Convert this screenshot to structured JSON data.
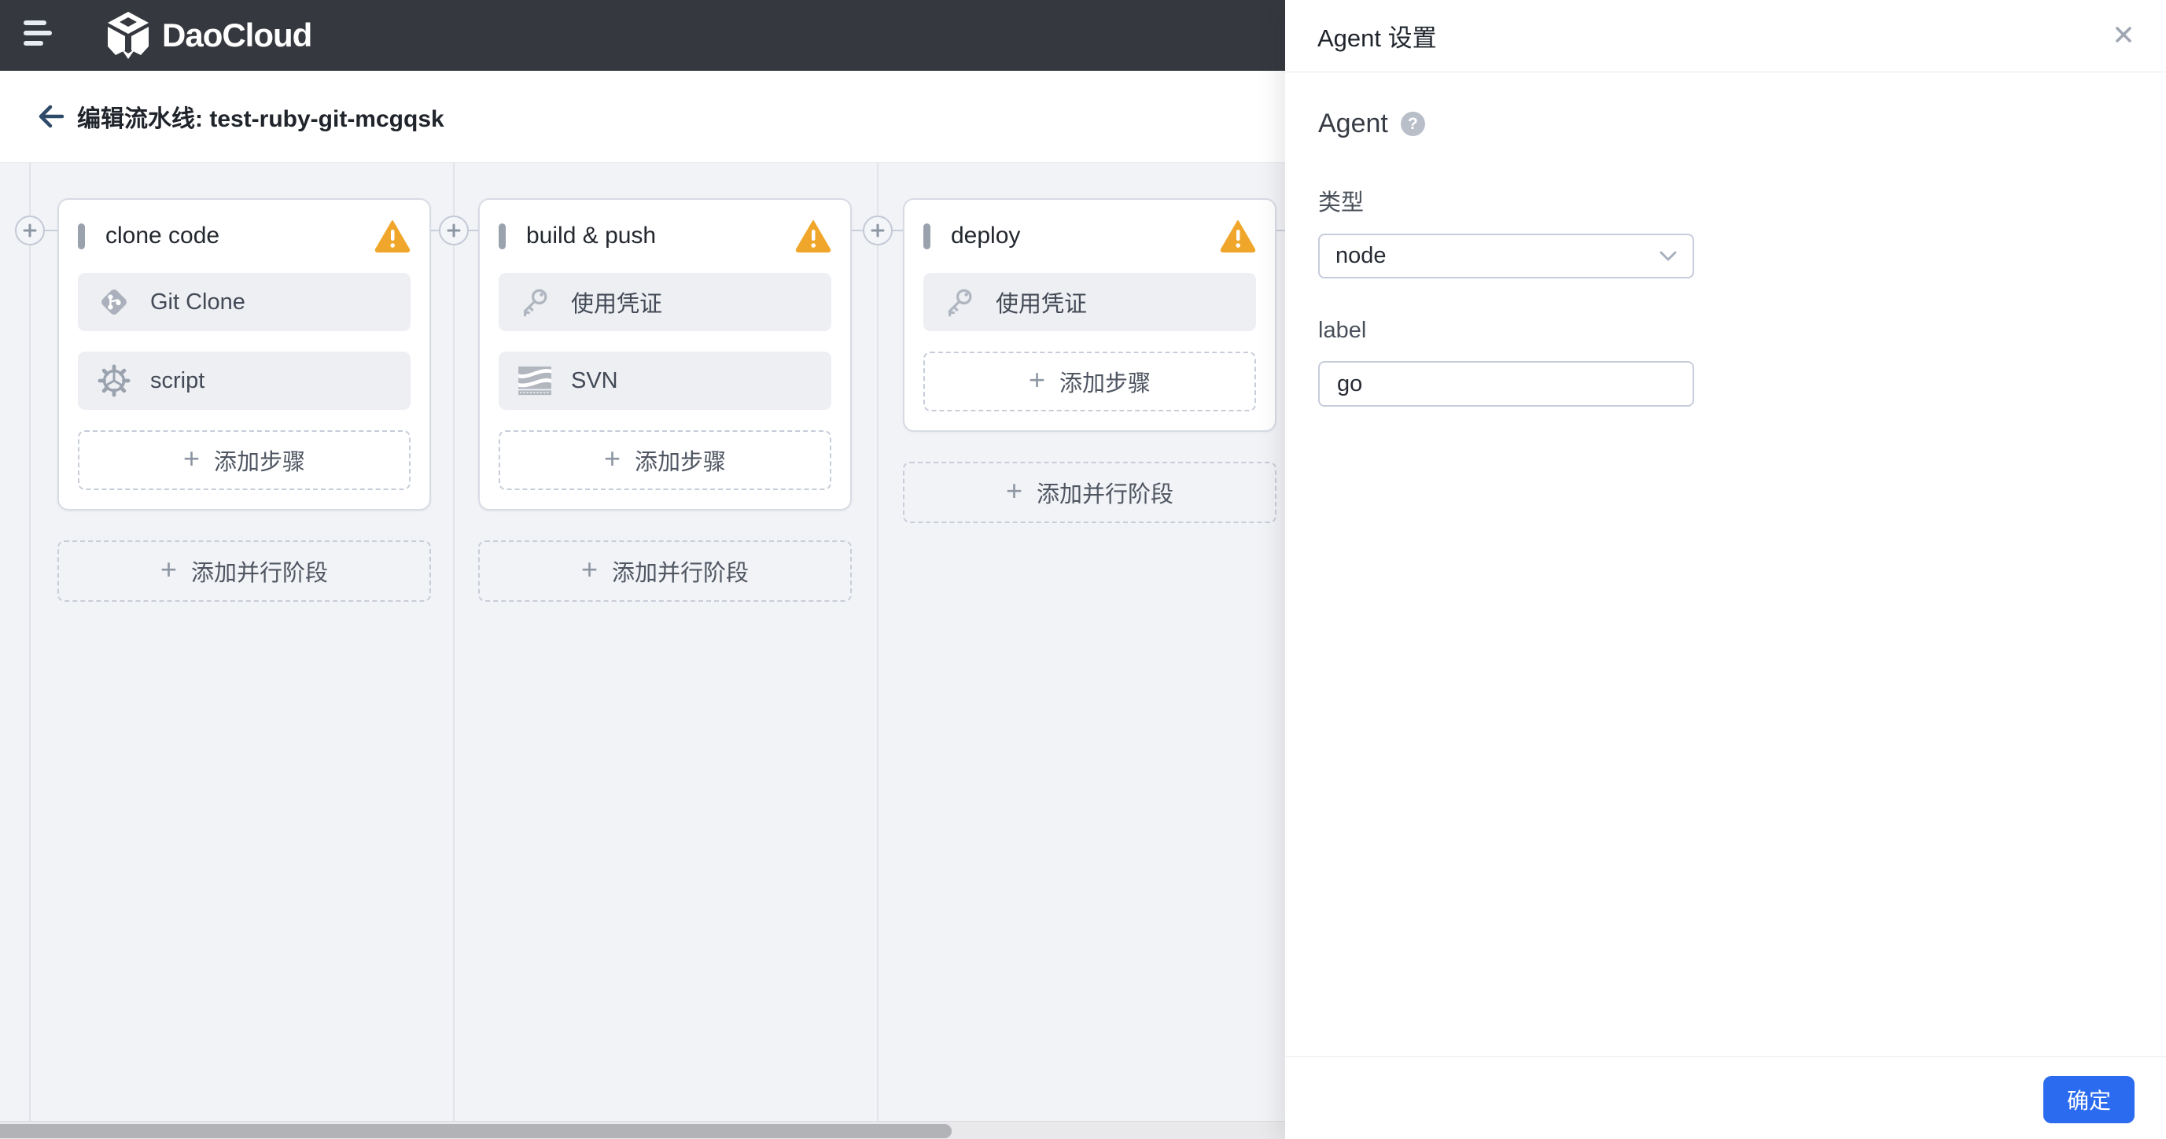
{
  "navbar": {
    "brand": "DaoCloud",
    "icons": [
      "menu-icon",
      "daocloud-logo"
    ]
  },
  "header": {
    "title": "编辑流水线: test-ruby-git-mcgqsk",
    "back_icon": "arrow-left-icon"
  },
  "pipeline": {
    "stages": [
      {
        "name": "clone code",
        "warning_icon": "warning-triangle-icon",
        "steps": [
          {
            "icon": "git-icon",
            "label": "Git Clone"
          },
          {
            "icon": "gear-icon",
            "label": "script"
          }
        ],
        "add_step_label": "添加步骤",
        "add_parallel_label": "添加并行阶段"
      },
      {
        "name": "build & push",
        "warning_icon": "warning-triangle-icon",
        "steps": [
          {
            "icon": "key-icon",
            "label": "使用凭证"
          },
          {
            "icon": "svn-icon",
            "label": "SVN"
          }
        ],
        "add_step_label": "添加步骤",
        "add_parallel_label": "添加并行阶段"
      },
      {
        "name": "deploy",
        "warning_icon": "warning-triangle-icon",
        "steps": [
          {
            "icon": "key-icon",
            "label": "使用凭证"
          }
        ],
        "add_step_label": "添加步骤",
        "add_parallel_label": "添加并行阶段"
      }
    ],
    "plus_symbol": "+"
  },
  "panel": {
    "title": "Agent 设置",
    "close_icon": "close-icon",
    "section_title": "Agent",
    "help_symbol": "?",
    "fields": [
      {
        "label": "类型",
        "control": "select",
        "value": "node"
      },
      {
        "label": "label",
        "control": "input",
        "value": "go"
      }
    ],
    "confirm_label": "确定"
  },
  "colors": {
    "navbar_bg": "#35383e",
    "canvas_bg": "#f2f3f6",
    "warning": "#f0a62a",
    "primary_blue": "#2b6bf0",
    "icon_gray": "#a7aeb9"
  }
}
